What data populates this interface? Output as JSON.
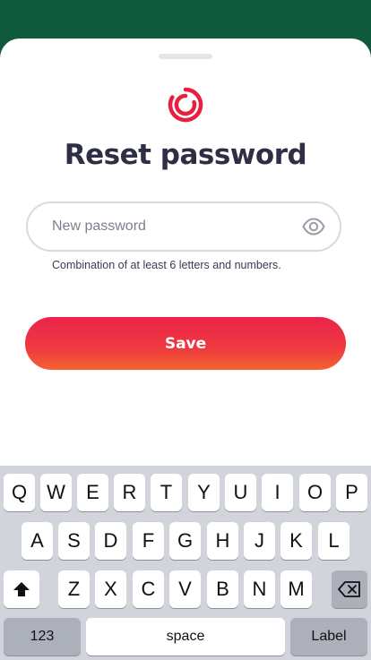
{
  "header": {
    "title": "Reset password"
  },
  "form": {
    "password_placeholder": "New password",
    "password_value": "",
    "hint": "Combination of at least 6 letters and numbers.",
    "save_label": "Save"
  },
  "icons": {
    "logo": "brand-logo-icon",
    "visibility": "eye-icon"
  },
  "colors": {
    "brand_green": "#0f5a3c",
    "accent_red": "#ec234a",
    "accent_orange": "#f36431",
    "title_text": "#2e2f45"
  },
  "keyboard": {
    "row1": [
      "Q",
      "W",
      "E",
      "R",
      "T",
      "Y",
      "U",
      "I",
      "O",
      "P"
    ],
    "row2": [
      "A",
      "S",
      "D",
      "F",
      "G",
      "H",
      "J",
      "K",
      "L"
    ],
    "row3": [
      "Z",
      "X",
      "C",
      "V",
      "B",
      "N",
      "M"
    ],
    "numbers_key": "123",
    "space_key": "space",
    "return_key": "Label"
  }
}
